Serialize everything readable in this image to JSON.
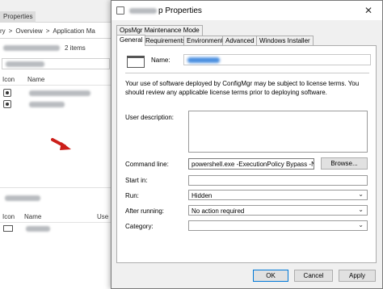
{
  "background_console": {
    "properties_tab": "Properties",
    "breadcrumb": [
      "ry",
      ">",
      "Overview",
      ">",
      "Application Ma"
    ],
    "items_count": "2 items",
    "columns": {
      "icon": "Icon",
      "name": "Name"
    },
    "bottom_columns": {
      "icon": "Icon",
      "name": "Name",
      "user": "Use"
    }
  },
  "dialog": {
    "title_suffix": "p Properties",
    "close_glyph": "✕",
    "tabs_row1": [
      "OpsMgr Maintenance Mode"
    ],
    "tabs_row2": [
      "General",
      "Requirements",
      "Environment",
      "Advanced",
      "Windows Installer"
    ],
    "active_tab": "General",
    "name_label": "Name:",
    "notice": "Your use of software deployed by ConfigMgr may be subject to license terms. You should review any applicable license terms prior to deploying software.",
    "user_description_label": "User description:",
    "command_line_label": "Command line:",
    "command_line_value": "powershell.exe -ExecutionPolicy Bypass -NoLogo",
    "browse_button": "Browse...",
    "start_in_label": "Start in:",
    "run_label": "Run:",
    "run_value": "Hidden",
    "after_running_label": "After running:",
    "after_running_value": "No action required",
    "category_label": "Category:",
    "category_value": "",
    "buttons": {
      "ok": "OK",
      "cancel": "Cancel",
      "apply": "Apply"
    },
    "arrow_color": "#cc1f1a"
  }
}
